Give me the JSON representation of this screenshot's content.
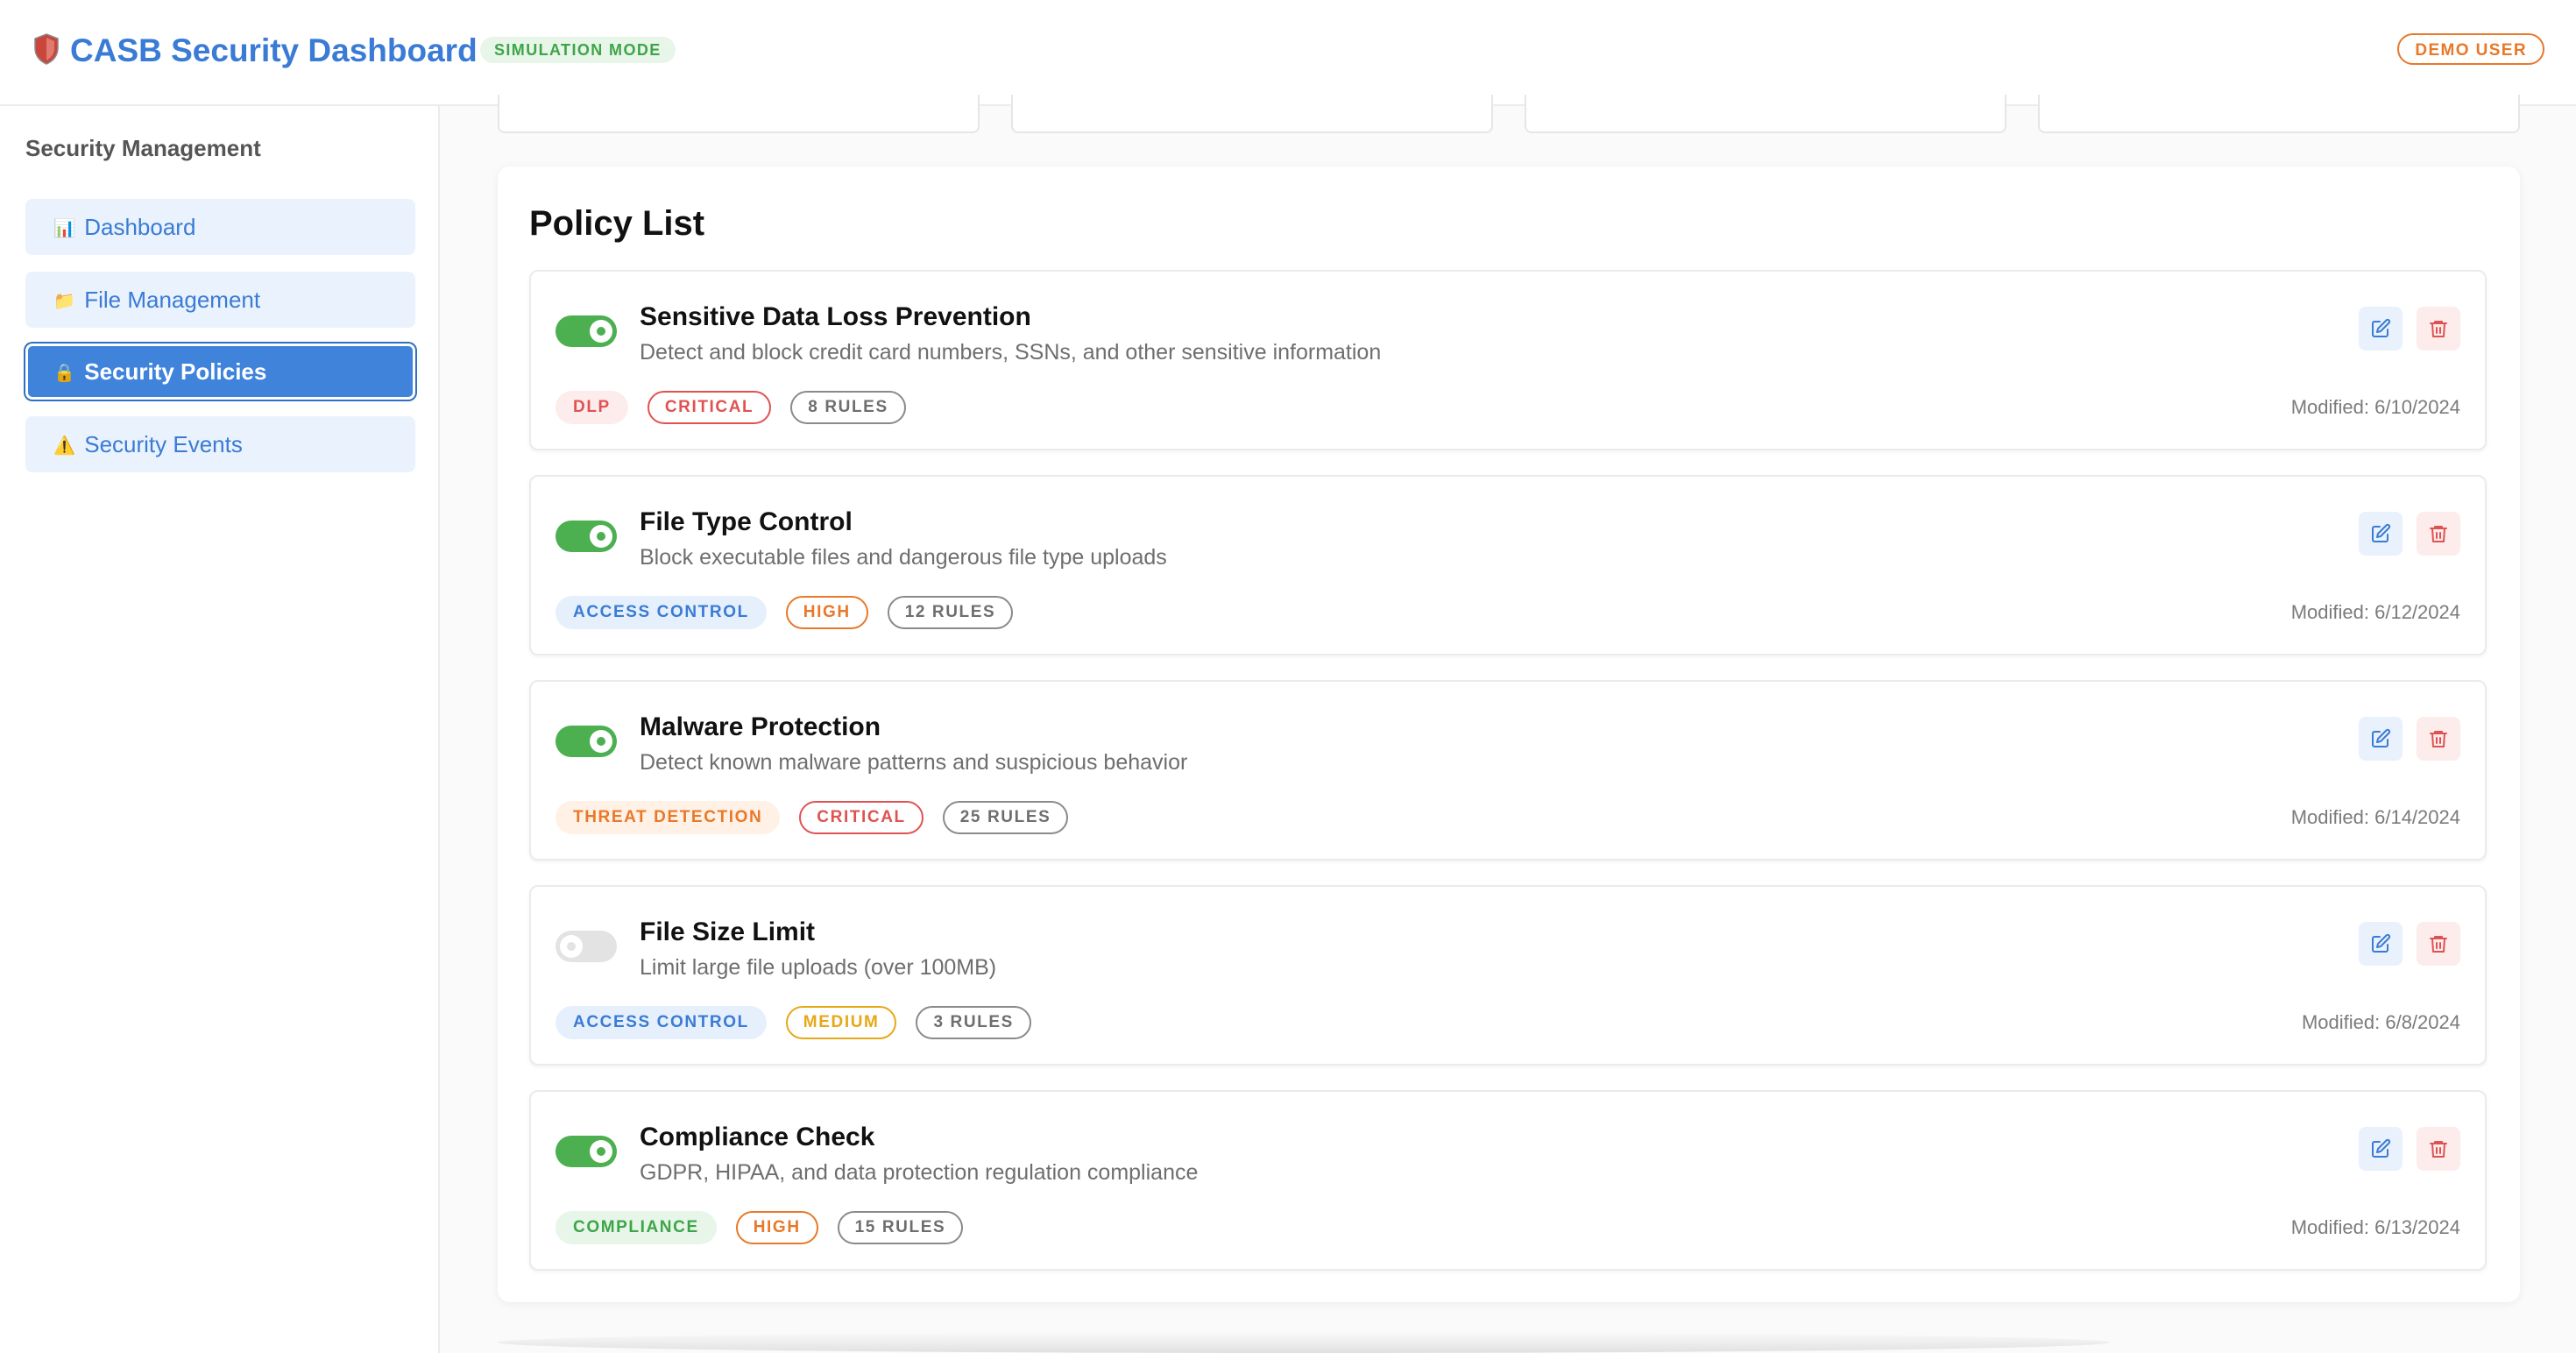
{
  "header": {
    "title": "CASB Security Dashboard",
    "mode_badge": "SIMULATION MODE",
    "user_badge": "DEMO USER"
  },
  "sidebar": {
    "heading": "Security Management",
    "items": [
      {
        "icon": "📊",
        "label": "Dashboard",
        "active": false
      },
      {
        "icon": "📁",
        "label": "File Management",
        "active": false
      },
      {
        "icon": "🔒",
        "label": "Security Policies",
        "active": true
      },
      {
        "icon": "⚠️",
        "label": "Security Events",
        "active": false
      }
    ]
  },
  "main": {
    "panel_title": "Policy List",
    "policies": [
      {
        "name": "Sensitive Data Loss Prevention",
        "description": "Detect and block credit card numbers, SSNs, and other sensitive information",
        "enabled": true,
        "category": "DLP",
        "severity": "CRITICAL",
        "rules": "8 RULES",
        "modified": "Modified: 6/10/2024"
      },
      {
        "name": "File Type Control",
        "description": "Block executable files and dangerous file type uploads",
        "enabled": true,
        "category": "ACCESS CONTROL",
        "severity": "HIGH",
        "rules": "12 RULES",
        "modified": "Modified: 6/12/2024"
      },
      {
        "name": "Malware Protection",
        "description": "Detect known malware patterns and suspicious behavior",
        "enabled": true,
        "category": "THREAT DETECTION",
        "severity": "CRITICAL",
        "rules": "25 RULES",
        "modified": "Modified: 6/14/2024"
      },
      {
        "name": "File Size Limit",
        "description": "Limit large file uploads (over 100MB)",
        "enabled": false,
        "category": "ACCESS CONTROL",
        "severity": "MEDIUM",
        "rules": "3 RULES",
        "modified": "Modified: 6/8/2024"
      },
      {
        "name": "Compliance Check",
        "description": "GDPR, HIPAA, and data protection regulation compliance",
        "enabled": true,
        "category": "COMPLIANCE",
        "severity": "HIGH",
        "rules": "15 RULES",
        "modified": "Modified: 6/13/2024"
      }
    ]
  },
  "colors": {
    "accent": "#3a7bd5",
    "toggle_on": "#4caf50",
    "category": {
      "DLP": {
        "bg": "#fdecec",
        "fg": "#e05252"
      },
      "ACCESS CONTROL": {
        "bg": "#e6f0fc",
        "fg": "#3a7bd5"
      },
      "THREAT DETECTION": {
        "bg": "#fff1e5",
        "fg": "#e8782a"
      },
      "COMPLIANCE": {
        "bg": "#e8f5e9",
        "fg": "#3da548"
      }
    },
    "severity": {
      "CRITICAL": "#e05252",
      "HIGH": "#e8782a",
      "MEDIUM": "#e6a817"
    },
    "rules_border": "#8a8a8a"
  },
  "icons": {
    "brand": "shield-icon",
    "edit": "edit-icon",
    "delete": "trash-icon"
  }
}
